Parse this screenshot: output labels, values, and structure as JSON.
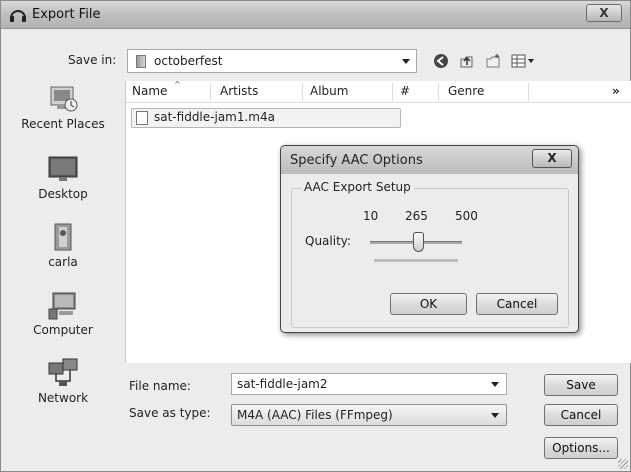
{
  "window": {
    "title": "Export File",
    "close_label": "X"
  },
  "toolbar": {
    "save_in_label": "Save in:",
    "save_in_value": "octoberfest",
    "icons": [
      "back-icon",
      "up-folder-icon",
      "new-folder-icon",
      "view-menu-icon"
    ]
  },
  "places": [
    {
      "label": "Recent Places",
      "icon": "recent-places-icon"
    },
    {
      "label": "Desktop",
      "icon": "desktop-icon"
    },
    {
      "label": "carla",
      "icon": "user-folder-icon"
    },
    {
      "label": "Computer",
      "icon": "computer-icon"
    },
    {
      "label": "Network",
      "icon": "network-icon"
    }
  ],
  "file_list": {
    "columns": [
      "Name",
      "Artists",
      "Album",
      "#",
      "Genre"
    ],
    "more": "»",
    "files": [
      "sat-fiddle-jam1.m4a"
    ]
  },
  "form": {
    "file_name_label": "File name:",
    "file_name_value": "sat-fiddle-jam2",
    "save_type_label": "Save as type:",
    "save_type_value": "M4A (AAC) Files (FFmpeg)"
  },
  "buttons": {
    "save": "Save",
    "cancel": "Cancel",
    "options": "Options..."
  },
  "aac_dialog": {
    "title": "Specify AAC Options",
    "close_label": "X",
    "group_label": "AAC Export Setup",
    "ticks": [
      "10",
      "265",
      "500"
    ],
    "quality_label": "Quality:",
    "quality_min": 10,
    "quality_max": 500,
    "quality_value": 265,
    "ok": "OK",
    "cancel": "Cancel"
  }
}
